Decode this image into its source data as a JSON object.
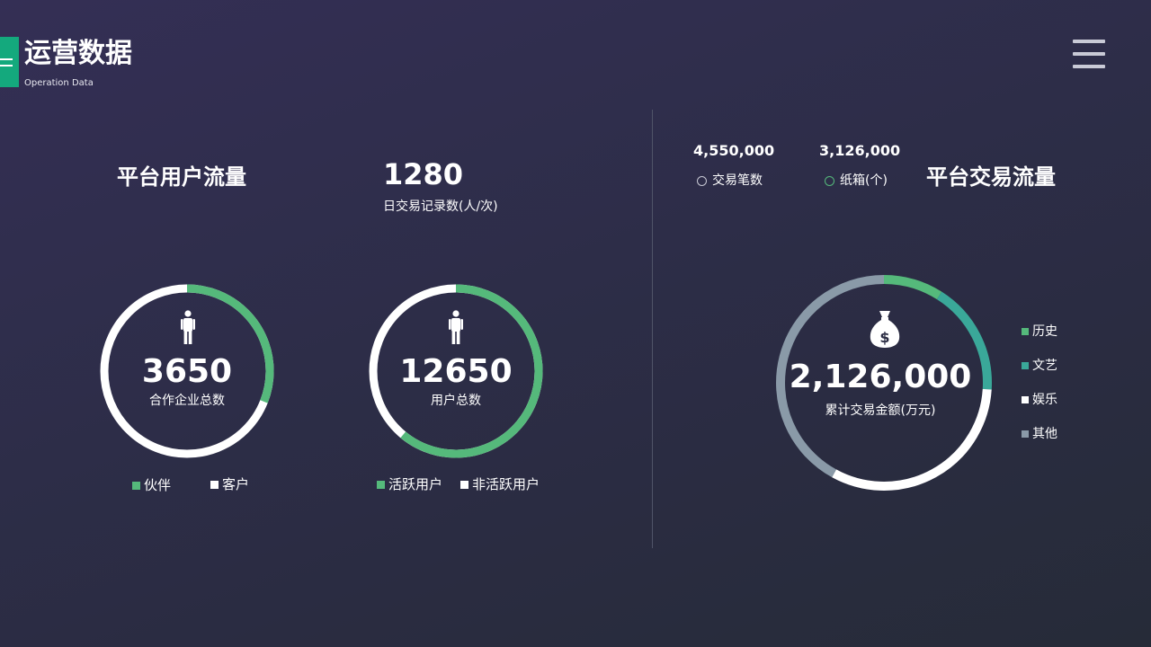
{
  "header": {
    "title": "运营数据",
    "subtitle": "Operation Data",
    "accent_color": "#14a97d",
    "menu_icon": "hamburger-menu-icon"
  },
  "left_section": {
    "title": "平台用户流量",
    "daily_stat": {
      "value": "1280",
      "caption": "日交易记录数(人/次)"
    },
    "donuts": [
      {
        "icon": "person-icon",
        "value": "3650",
        "label": "合作企业总数",
        "green_fraction": 0.31,
        "legend": [
          {
            "label": "伙伴",
            "color": "#55b97b"
          },
          {
            "label": "客户",
            "color": "#ffffff"
          }
        ]
      },
      {
        "icon": "person-icon",
        "value": "12650",
        "label": "用户总数",
        "green_fraction": 0.61,
        "legend": [
          {
            "label": "活跃用户",
            "color": "#55b97b"
          },
          {
            "label": "非活跃用户",
            "color": "#ffffff"
          }
        ]
      }
    ]
  },
  "right_section": {
    "title": "平台交易流量",
    "mini_stats": [
      {
        "value": "4,550,000",
        "caption": "交易笔数",
        "marker_color": "#c8c8d4"
      },
      {
        "value": "3,126,000",
        "caption": "纸箱(个)",
        "marker_color": "#55b97b"
      }
    ],
    "donut": {
      "icon": "money-bag-icon",
      "value": "2,126,000",
      "label": "累计交易金额(万元)"
    },
    "legend": [
      {
        "label": "历史",
        "color": "#55b97b"
      },
      {
        "label": "文艺",
        "color": "#3aa899"
      },
      {
        "label": "娱乐",
        "color": "#ffffff"
      },
      {
        "label": "其他",
        "color": "#8a9aa8"
      }
    ]
  },
  "chart_data": {
    "type": "pie",
    "categories": [
      "历史",
      "文艺",
      "娱乐",
      "其他"
    ],
    "values": [
      0.09,
      0.17,
      0.32,
      0.42
    ],
    "center_value": "2,126,000",
    "center_label": "累计交易金额(万元)"
  }
}
